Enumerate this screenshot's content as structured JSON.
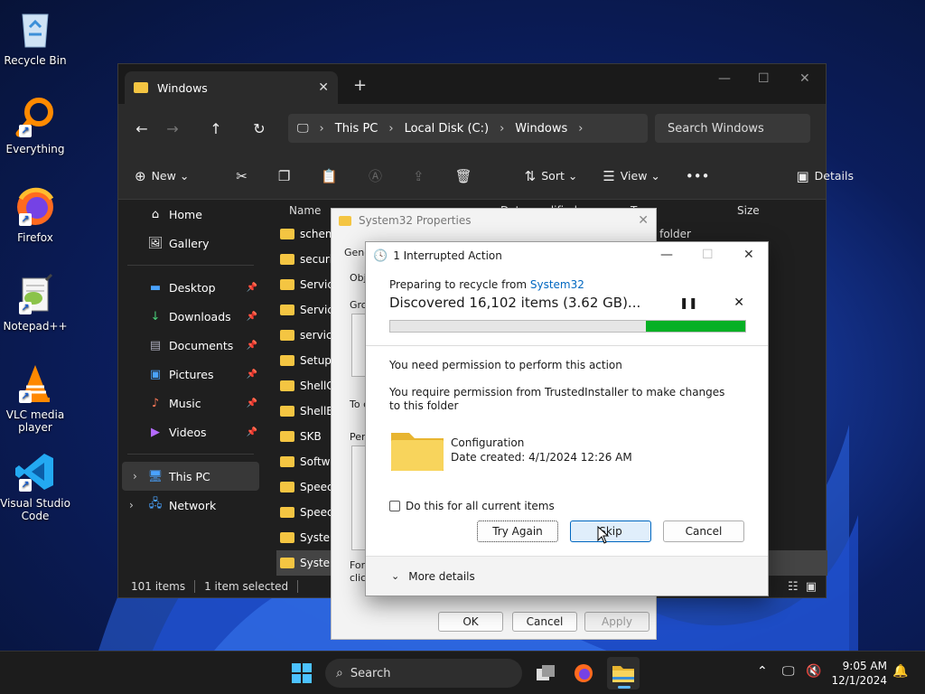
{
  "desktop": {
    "icons": [
      {
        "label": "Recycle Bin"
      },
      {
        "label": "Everything"
      },
      {
        "label": "Firefox"
      },
      {
        "label": "Notepad++"
      },
      {
        "label": "VLC media player"
      },
      {
        "label": "Visual Studio Code"
      }
    ]
  },
  "explorer": {
    "tab_title": "Windows",
    "breadcrumb": [
      "This PC",
      "Local Disk (C:)",
      "Windows"
    ],
    "search_placeholder": "Search Windows",
    "toolbar": {
      "new": "New",
      "sort": "Sort",
      "view": "View",
      "details": "Details"
    },
    "sidebar": {
      "home": "Home",
      "gallery": "Gallery",
      "desktop": "Desktop",
      "downloads": "Downloads",
      "documents": "Documents",
      "pictures": "Pictures",
      "music": "Music",
      "videos": "Videos",
      "this_pc": "This PC",
      "network": "Network"
    },
    "columns": {
      "name": "Name",
      "date": "Date modified",
      "type": "Type",
      "size": "Size"
    },
    "type_partial": "e folder",
    "files": [
      "schema",
      "security",
      "Service",
      "Service",
      "servicin",
      "Setup",
      "ShellCo",
      "ShellEx",
      "SKB",
      "Softwa",
      "Speech",
      "Speech",
      "System",
      "System"
    ],
    "status": {
      "items": "101 items",
      "selected": "1 item selected"
    }
  },
  "properties": {
    "title": "System32 Properties",
    "frag": {
      "gen": "Gene",
      "obj": "Obj",
      "gro": "Gro",
      "to": "To c",
      "perm": "Pern",
      "for": "For",
      "clic": "clic"
    },
    "buttons": {
      "ok": "OK",
      "cancel": "Cancel",
      "apply": "Apply"
    }
  },
  "dialog": {
    "title": "1 Interrupted Action",
    "preparing": "Preparing to recycle from",
    "source": "System32",
    "discovered": "Discovered 16,102 items (3.62 GB)...",
    "progress": 0.28,
    "permission_heading": "You need permission to perform this action",
    "permission_detail": "You require permission from TrustedInstaller to make changes to this folder",
    "item_name": "Configuration",
    "item_date": "Date created: 4/1/2024 12:26 AM",
    "checkbox_label": "Do this for all current items",
    "buttons": {
      "try_again": "Try Again",
      "skip": "Skip",
      "cancel": "Cancel"
    },
    "more_details": "More details"
  },
  "taskbar": {
    "search": "Search",
    "time": "9:05 AM",
    "date": "12/1/2024"
  },
  "colors": {
    "progress": "#06b025",
    "accent": "#0067c0",
    "folder": "#f4c542"
  }
}
